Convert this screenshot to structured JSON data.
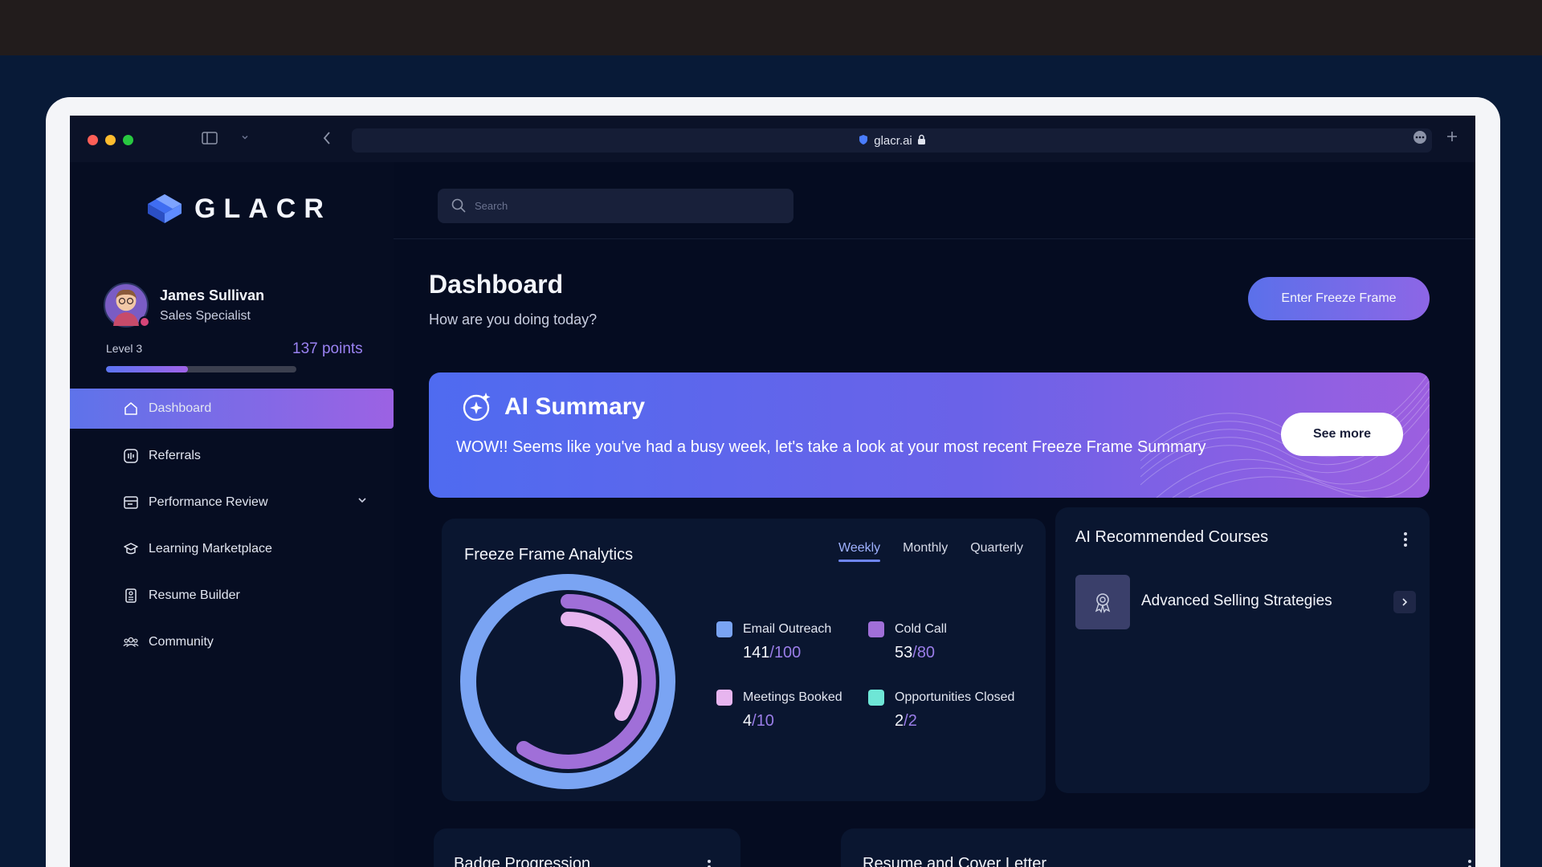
{
  "browser": {
    "url": "glacr.ai"
  },
  "app": {
    "logo_text": "GLACR"
  },
  "user": {
    "name": "James Sullivan",
    "role": "Sales Specialist",
    "level": "Level 3",
    "points": "137 points",
    "level_progress": 0.43
  },
  "sidebar": {
    "items": [
      {
        "label": "Dashboard",
        "icon": "home-icon",
        "active": true
      },
      {
        "label": "Referrals",
        "icon": "referrals-icon"
      },
      {
        "label": "Performance Review",
        "icon": "calendar-icon",
        "expandable": true
      },
      {
        "label": "Learning Marketplace",
        "icon": "graduation-icon"
      },
      {
        "label": "Resume Builder",
        "icon": "document-icon"
      },
      {
        "label": "Community",
        "icon": "people-icon"
      }
    ]
  },
  "search": {
    "placeholder": "Search"
  },
  "header": {
    "title": "Dashboard",
    "subtitle": "How are you doing today?",
    "freeze_button": "Enter Freeze Frame"
  },
  "ai_summary": {
    "title": "AI Summary",
    "text": "WOW!! Seems like you've had a busy week, let's take a look at your most recent Freeze Frame Summary",
    "button": "See more"
  },
  "analytics": {
    "title": "Freeze Frame Analytics",
    "tabs": [
      "Weekly",
      "Monthly",
      "Quarterly"
    ],
    "active_tab": "Weekly",
    "metrics": [
      {
        "label": "Email Outreach",
        "value": "141",
        "target": "100",
        "color": "#7aa4f3"
      },
      {
        "label": "Cold Call",
        "value": "53",
        "target": "80",
        "color": "#a06fd8"
      },
      {
        "label": "Meetings Booked",
        "value": "4",
        "target": "10",
        "color": "#e7b5ef"
      },
      {
        "label": "Opportunities Closed",
        "value": "2",
        "target": "2",
        "color": "#6ee6d6"
      }
    ]
  },
  "courses": {
    "title": "AI Recommended Courses",
    "items": [
      {
        "name": "Advanced Selling Strategies"
      }
    ]
  },
  "bottom_cards": {
    "badge_title": "Badge Progression",
    "resume_title": "Resume and Cover Letter"
  },
  "colors": {
    "accent_start": "#5b70ea",
    "accent_end": "#9c62e3",
    "background": "#050c21"
  }
}
